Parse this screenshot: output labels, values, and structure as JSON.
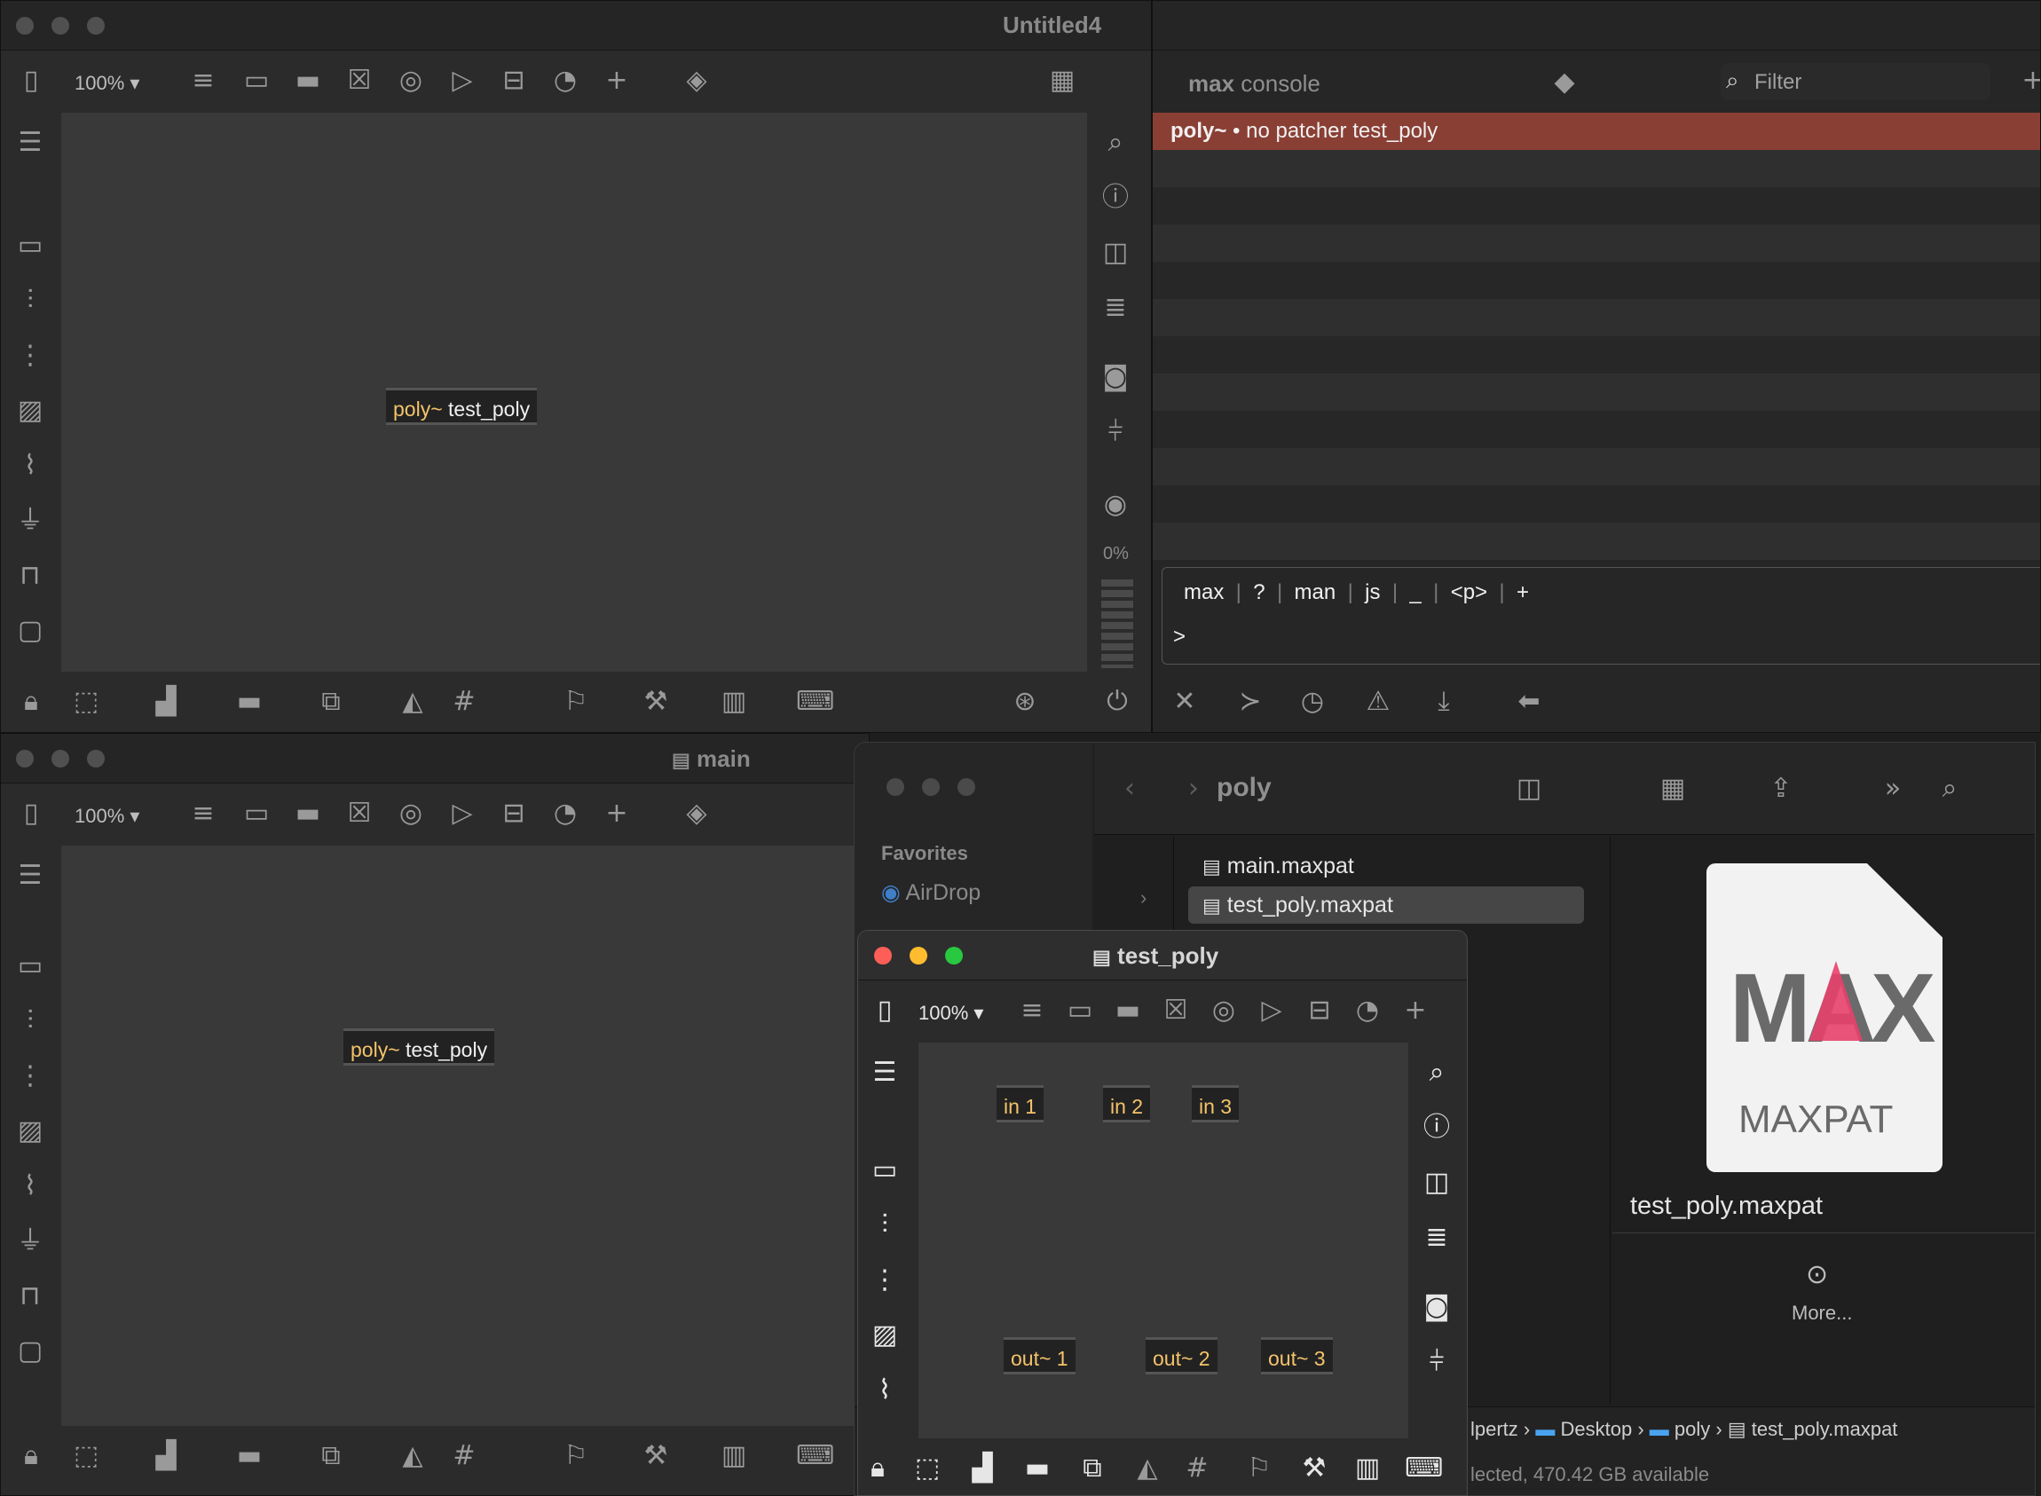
{
  "untitled_window": {
    "title": "Untitled4",
    "zoom": "100% ▾",
    "object": {
      "keyword": "poly~",
      "arg": " test_poly"
    },
    "cpu": "0%"
  },
  "console": {
    "title_bold": "max",
    "title_rest": " console",
    "filter_placeholder": "Filter",
    "error": {
      "source": "poly~",
      "sep": " • ",
      "message": "no patcher test_poly"
    },
    "command_tabs": [
      "max",
      "?",
      "man",
      "js",
      "_",
      "<p>",
      "+"
    ],
    "prompt": ">"
  },
  "main_window": {
    "title": "main",
    "zoom": "100% ▾",
    "object": {
      "keyword": "poly~",
      "arg": " test_poly"
    }
  },
  "finder": {
    "folder": "poly",
    "sidebar_header": "Favorites",
    "sidebar_items": [
      "AirDrop"
    ],
    "files": [
      "main.maxpat",
      "test_poly.maxpat"
    ],
    "preview_name": "test_poly.maxpat",
    "preview_icon_text": "MAXPAT",
    "more_label": "More...",
    "path": [
      "lpertz",
      "Desktop",
      "poly",
      "test_poly.maxpat"
    ],
    "status": "lected, 470.42 GB available"
  },
  "test_poly_window": {
    "title": "test_poly",
    "zoom": "100% ▾",
    "inlets": [
      "in 1",
      "in 2",
      "in 3"
    ],
    "outlets": [
      "out~ 1",
      "out~ 2",
      "out~ 3"
    ]
  },
  "colors": {
    "error_bg": "#8a3f35",
    "keyword": "#f4c36a",
    "canvas": "#393939",
    "close_red": "#fd5f57",
    "min_yellow": "#febc2e",
    "max_green": "#28c840",
    "folder_blue": "#4aa3f0"
  }
}
